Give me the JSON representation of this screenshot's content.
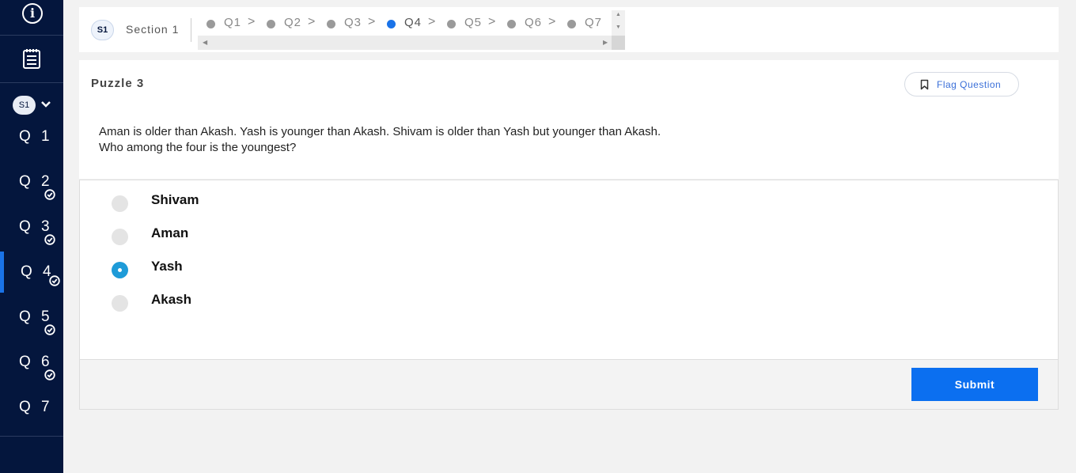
{
  "sidebar": {
    "info_glyph": "i",
    "section_badge": "S1",
    "questions": [
      {
        "label": "Q 1",
        "answered": false,
        "active": false
      },
      {
        "label": "Q 2",
        "answered": true,
        "active": false
      },
      {
        "label": "Q 3",
        "answered": true,
        "active": false
      },
      {
        "label": "Q 4",
        "answered": true,
        "active": true
      },
      {
        "label": "Q 5",
        "answered": true,
        "active": false
      },
      {
        "label": "Q 6",
        "answered": true,
        "active": false
      },
      {
        "label": "Q 7",
        "answered": false,
        "active": false
      }
    ],
    "icons": [
      "info-icon",
      "notes-icon",
      "chevron-down-icon",
      "check-circle-icon"
    ]
  },
  "topbar": {
    "section_badge": "S1",
    "section_label": "Section 1",
    "steps": [
      "Q1",
      "Q2",
      "Q3",
      "Q4",
      "Q5",
      "Q6",
      "Q7"
    ],
    "current_step": "Q4"
  },
  "question": {
    "title": "Puzzle 3",
    "flag_label": "Flag Question",
    "text_line1": "Aman is older than Akash. Yash is younger than Akash. Shivam is older than Yash but younger than Akash.",
    "text_line2": "Who among the four is the youngest?"
  },
  "options": [
    {
      "label": "Shivam",
      "selected": false
    },
    {
      "label": "Aman",
      "selected": false
    },
    {
      "label": "Yash",
      "selected": true
    },
    {
      "label": "Akash",
      "selected": false
    }
  ],
  "footer": {
    "submit_label": "Submit"
  },
  "colors": {
    "sidebar_bg": "#04163d",
    "accent": "#1a73e8",
    "selected_radio": "#1e9bd8",
    "submit_bg": "#0b6ff0"
  }
}
